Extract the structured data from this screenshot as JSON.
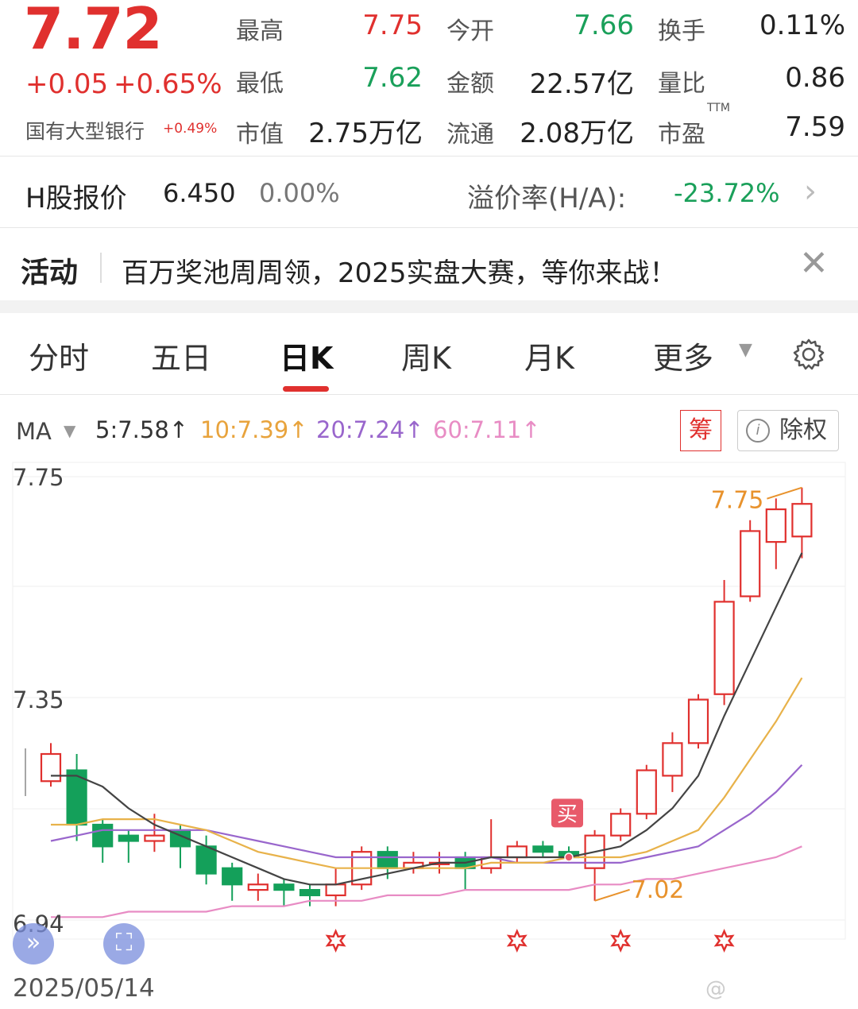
{
  "quote": {
    "price": "7.72",
    "change": "+0.05",
    "change_pct": "+0.65%",
    "sector": "国有大型银行",
    "sector_change": "+0.49%",
    "fields": [
      {
        "label": "最高",
        "value": "7.75",
        "color": "red"
      },
      {
        "label": "今开",
        "value": "7.66",
        "color": "green"
      },
      {
        "label": "换手",
        "value": "0.11%",
        "color": "dark"
      },
      {
        "label": "最低",
        "value": "7.62",
        "color": "green"
      },
      {
        "label": "金额",
        "value": "22.57亿",
        "color": "dark"
      },
      {
        "label": "量比",
        "value": "0.86",
        "color": "dark"
      },
      {
        "label": "市值",
        "value": "2.75万亿",
        "color": "dark"
      },
      {
        "label": "流通",
        "value": "2.08万亿",
        "color": "dark"
      },
      {
        "label": "市盈",
        "value": "7.59",
        "color": "dark"
      }
    ],
    "ttm": "TTM"
  },
  "hshare": {
    "label": "H股报价",
    "price": "6.450",
    "change": "0.00%",
    "premium_label": "溢价率(H/A):",
    "premium_value": "-23.72%"
  },
  "activity": {
    "label": "活动",
    "text": "百万奖池周周领，2025实盘大赛，等你来战！",
    "close": "✕"
  },
  "tabs": [
    {
      "label": "分时",
      "active": false
    },
    {
      "label": "五日",
      "active": false
    },
    {
      "label": "日K",
      "active": true
    },
    {
      "label": "周K",
      "active": false
    },
    {
      "label": "月K",
      "active": false
    },
    {
      "label": "更多",
      "active": false
    }
  ],
  "ma_bar": {
    "label": "MA",
    "values": [
      {
        "text": "5:7.58↑",
        "color": "#333333"
      },
      {
        "text": "10:7.39↑",
        "color": "#e8a33c"
      },
      {
        "text": "20:7.24↑",
        "color": "#9966cc"
      },
      {
        "text": "60:7.11↑",
        "color": "#e88cc4"
      }
    ],
    "chip_button": "筹",
    "exright_button": "除权",
    "exright_icon": "i"
  },
  "chart_data": {
    "type": "candlestick",
    "y_ticks": [
      "7.75",
      "7.35",
      "6.94"
    ],
    "ylim": [
      6.94,
      7.77
    ],
    "colors": {
      "up": "#e0302e",
      "down": "#14a05a",
      "ma5": "#444444",
      "ma10": "#e8b24a",
      "ma20": "#9966cc",
      "ma60": "#e88cc4"
    },
    "candles": [
      {
        "o": 7.21,
        "c": 7.26,
        "h": 7.28,
        "l": 7.2
      },
      {
        "o": 7.23,
        "c": 7.13,
        "h": 7.26,
        "l": 7.1
      },
      {
        "o": 7.13,
        "c": 7.09,
        "h": 7.14,
        "l": 7.06
      },
      {
        "o": 7.11,
        "c": 7.1,
        "h": 7.12,
        "l": 7.06
      },
      {
        "o": 7.1,
        "c": 7.11,
        "h": 7.15,
        "l": 7.08
      },
      {
        "o": 7.12,
        "c": 7.09,
        "h": 7.13,
        "l": 7.05
      },
      {
        "o": 7.09,
        "c": 7.04,
        "h": 7.11,
        "l": 7.02
      },
      {
        "o": 7.05,
        "c": 7.02,
        "h": 7.06,
        "l": 6.99
      },
      {
        "o": 7.01,
        "c": 7.02,
        "h": 7.04,
        "l": 6.99
      },
      {
        "o": 7.02,
        "c": 7.01,
        "h": 7.03,
        "l": 6.98
      },
      {
        "o": 7.01,
        "c": 7.0,
        "h": 7.02,
        "l": 6.98
      },
      {
        "o": 7.0,
        "c": 7.02,
        "h": 7.05,
        "l": 6.98
      },
      {
        "o": 7.02,
        "c": 7.08,
        "h": 7.09,
        "l": 7.01
      },
      {
        "o": 7.08,
        "c": 7.05,
        "h": 7.09,
        "l": 7.03
      },
      {
        "o": 7.05,
        "c": 7.06,
        "h": 7.08,
        "l": 7.04
      },
      {
        "o": 7.06,
        "c": 7.06,
        "h": 7.08,
        "l": 7.04
      },
      {
        "o": 7.07,
        "c": 7.05,
        "h": 7.08,
        "l": 7.01
      },
      {
        "o": 7.05,
        "c": 7.07,
        "h": 7.14,
        "l": 7.04
      },
      {
        "o": 7.07,
        "c": 7.09,
        "h": 7.1,
        "l": 7.06
      },
      {
        "o": 7.09,
        "c": 7.08,
        "h": 7.1,
        "l": 7.07
      },
      {
        "o": 7.08,
        "c": 7.07,
        "h": 7.09,
        "l": 7.06
      },
      {
        "o": 7.05,
        "c": 7.11,
        "h": 7.12,
        "l": 6.99
      },
      {
        "o": 7.11,
        "c": 7.15,
        "h": 7.16,
        "l": 7.1
      },
      {
        "o": 7.15,
        "c": 7.23,
        "h": 7.24,
        "l": 7.14
      },
      {
        "o": 7.22,
        "c": 7.28,
        "h": 7.3,
        "l": 7.19
      },
      {
        "o": 7.28,
        "c": 7.36,
        "h": 7.37,
        "l": 7.27
      },
      {
        "o": 7.37,
        "c": 7.54,
        "h": 7.58,
        "l": 7.35
      },
      {
        "o": 7.55,
        "c": 7.67,
        "h": 7.69,
        "l": 7.54
      },
      {
        "o": 7.65,
        "c": 7.71,
        "h": 7.73,
        "l": 7.6
      },
      {
        "o": 7.66,
        "c": 7.72,
        "h": 7.75,
        "l": 7.62
      }
    ],
    "ma5": [
      7.22,
      7.22,
      7.2,
      7.16,
      7.13,
      7.11,
      7.09,
      7.07,
      7.05,
      7.03,
      7.02,
      7.02,
      7.03,
      7.04,
      7.05,
      7.06,
      7.06,
      7.07,
      7.07,
      7.07,
      7.07,
      7.08,
      7.09,
      7.12,
      7.16,
      7.22,
      7.33,
      7.43,
      7.53,
      7.63
    ],
    "ma10": [
      7.13,
      7.13,
      7.14,
      7.14,
      7.14,
      7.13,
      7.12,
      7.1,
      7.08,
      7.07,
      7.06,
      7.05,
      7.05,
      7.05,
      7.05,
      7.05,
      7.05,
      7.06,
      7.06,
      7.06,
      7.07,
      7.07,
      7.07,
      7.08,
      7.1,
      7.12,
      7.18,
      7.25,
      7.32,
      7.4
    ],
    "ma20": [
      7.1,
      7.11,
      7.12,
      7.12,
      7.12,
      7.12,
      7.12,
      7.11,
      7.1,
      7.09,
      7.08,
      7.07,
      7.07,
      7.07,
      7.07,
      7.07,
      7.07,
      7.07,
      7.06,
      7.06,
      7.06,
      7.06,
      7.06,
      7.07,
      7.08,
      7.09,
      7.12,
      7.15,
      7.19,
      7.24
    ],
    "ma60": [
      6.96,
      6.96,
      6.96,
      6.97,
      6.97,
      6.97,
      6.97,
      6.98,
      6.98,
      6.98,
      6.99,
      6.99,
      6.99,
      7.0,
      7.0,
      7.0,
      7.01,
      7.01,
      7.01,
      7.01,
      7.01,
      7.02,
      7.02,
      7.03,
      7.03,
      7.04,
      7.05,
      7.06,
      7.07,
      7.09
    ],
    "annotations": {
      "high_label": "7.75",
      "low_label": "7.02",
      "buy_label": "买",
      "buy_index": 20
    },
    "event_marker_indices": [
      11,
      18,
      22,
      26
    ]
  },
  "footer": {
    "date": "2025/05/14",
    "expand_icon": "»",
    "watermark": "@"
  }
}
